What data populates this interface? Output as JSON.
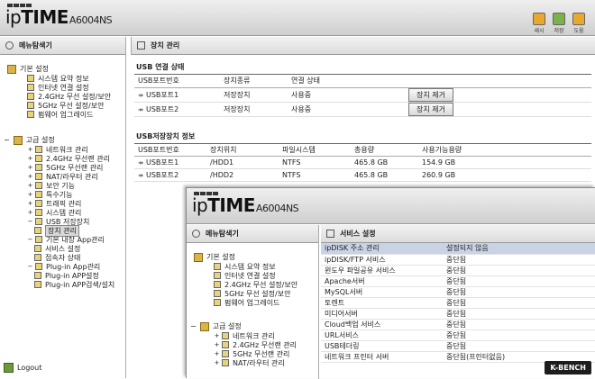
{
  "brand": {
    "logo_bold": "TIME",
    "logo_prefix": "ip",
    "model": "A6004NS"
  },
  "header_icons": [
    {
      "label": "새시",
      "icon": "refresh-icon",
      "color": "#e8a830"
    },
    {
      "label": "저장",
      "icon": "save-icon",
      "color": "#79b24b"
    },
    {
      "label": "도움",
      "icon": "help-icon",
      "color": "#e8a830"
    }
  ],
  "sidebar": {
    "title": "메뉴탐색기",
    "basic": {
      "label": "기본 설정",
      "items": [
        "시스템 요약 정보",
        "인터넷 연결 설정",
        "2.4GHz 무선 설정/보안",
        "5GHz 무선 설정/보안",
        "펌웨어 업그레이드"
      ]
    },
    "advanced": {
      "label": "고급 설정",
      "items": [
        "네트워크 관리",
        "2.4GHz 무선랜 관리",
        "5GHz 무선랜 관리",
        "NAT/라우터 관리",
        "보안 기능",
        "특수기능",
        "트래픽 관리",
        "시스템 관리",
        "USB 저장장치",
        "장치 관리",
        "기본 내장 App관리",
        "서비스 설정",
        "접속자 상태",
        "Plug-in App관리",
        "Plug-in APP설정",
        "Plug-in APP검색/설치"
      ]
    },
    "logout": "Logout"
  },
  "main": {
    "title": "장치 관리",
    "usb_status": {
      "title": "USB 연결 상태",
      "headers": [
        "USB포트번호",
        "장치종류",
        "연결 상태",
        ""
      ],
      "rows": [
        {
          "port": "USB포트1",
          "type": "저장장치",
          "state": "사용중",
          "button": "장치 제거"
        },
        {
          "port": "USB포트2",
          "type": "저장장치",
          "state": "사용중",
          "button": "장치 제거"
        }
      ]
    },
    "usb_storage": {
      "title": "USB저장장치 정보",
      "headers": [
        "USB포트번호",
        "장치위치",
        "파일시스템",
        "총용량",
        "사용가능용량"
      ],
      "rows": [
        {
          "port": "USB포트1",
          "loc": "/HDD1",
          "fs": "NTFS",
          "total": "465.8 GB",
          "free": "154.9 GB"
        },
        {
          "port": "USB포트2",
          "loc": "/HDD2",
          "fs": "NTFS",
          "total": "465.8 GB",
          "free": "260.9 GB"
        }
      ]
    }
  },
  "overlay": {
    "sidebar": {
      "title": "메뉴탐색기",
      "basic": {
        "label": "기본 설정",
        "items": [
          "시스템 요약 정보",
          "인터넷 연결 설정",
          "2.4GHz 무선 설정/보안",
          "5GHz 무선 설정/보안",
          "펌웨어 업그레이드"
        ]
      },
      "advanced": {
        "label": "고급 설정",
        "items": [
          "네트워크 관리",
          "2.4GHz 무선랜 관리",
          "5GHz 무선랜 관리",
          "NAT/라우터 관리"
        ]
      }
    },
    "main": {
      "title": "서비스 설정",
      "rows": [
        {
          "name": "ipDISK 주소 관리",
          "status": "설정되지 않음"
        },
        {
          "name": "ipDISK/FTP 서비스",
          "status": "중단됨"
        },
        {
          "name": "윈도우 파일공유 서비스",
          "status": "중단됨"
        },
        {
          "name": "Apache서버",
          "status": "중단됨"
        },
        {
          "name": "MySQL서버",
          "status": "중단됨"
        },
        {
          "name": "토렌트",
          "status": "중단됨"
        },
        {
          "name": "미디어서버",
          "status": "중단됨"
        },
        {
          "name": "Cloud백업 서비스",
          "status": "중단됨"
        },
        {
          "name": "URL서비스",
          "status": "중단됨"
        },
        {
          "name": "USB테더링",
          "status": "중단됨"
        },
        {
          "name": "네트워크 프린터 서버",
          "status": "중단됨(프린터없음)"
        }
      ]
    }
  },
  "watermark": "K-BENCH"
}
